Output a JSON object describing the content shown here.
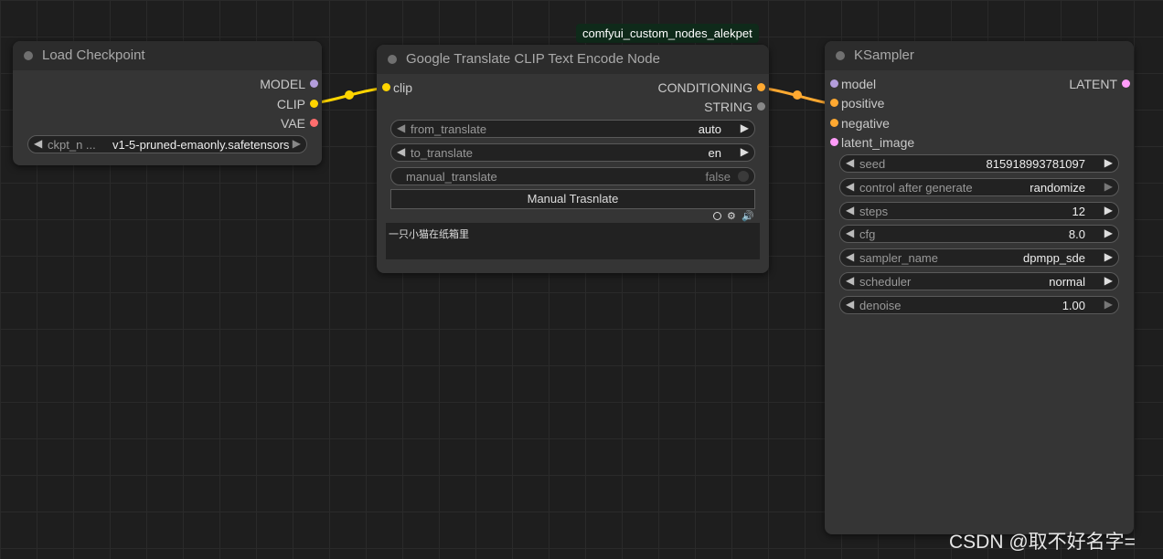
{
  "badge": "comfyui_custom_nodes_alekpet",
  "colors": {
    "model": "#b39ddb",
    "clip": "#ffd500",
    "vae": "#ff6e6e",
    "conditioning": "#ffa931",
    "latent": "#ff9cf9",
    "string": "#888888",
    "link_clip": "#ffd500",
    "link_conditioning": "#ffa931"
  },
  "load_checkpoint": {
    "title": "Load Checkpoint",
    "outputs": [
      "MODEL",
      "CLIP",
      "VAE"
    ],
    "ckpt": {
      "label": "ckpt_n ...",
      "value": "v1-5-pruned-emaonly.safetensors"
    }
  },
  "translate_node": {
    "title": "Google Translate CLIP Text Encode Node",
    "input": "clip",
    "outputs": [
      "CONDITIONING",
      "STRING"
    ],
    "widgets": [
      {
        "label": "from_translate",
        "value": "auto"
      },
      {
        "label": "to_translate",
        "value": "en"
      }
    ],
    "manual_toggle": {
      "label": "manual_translate",
      "value": "false"
    },
    "button": "Manual Trasnlate",
    "text": "一只小猫在纸箱里"
  },
  "ksampler": {
    "title": "KSampler",
    "inputs": [
      "model",
      "positive",
      "negative",
      "latent_image"
    ],
    "output": "LATENT",
    "widgets": [
      {
        "label": "seed",
        "value": "815918993781097"
      },
      {
        "label": "control after generate",
        "value": "randomize"
      },
      {
        "label": "steps",
        "value": "12"
      },
      {
        "label": "cfg",
        "value": "8.0"
      },
      {
        "label": "sampler_name",
        "value": "dpmpp_sde"
      },
      {
        "label": "scheduler",
        "value": "normal"
      },
      {
        "label": "denoise",
        "value": "1.00"
      }
    ]
  },
  "watermark": "CSDN @取不好名字="
}
